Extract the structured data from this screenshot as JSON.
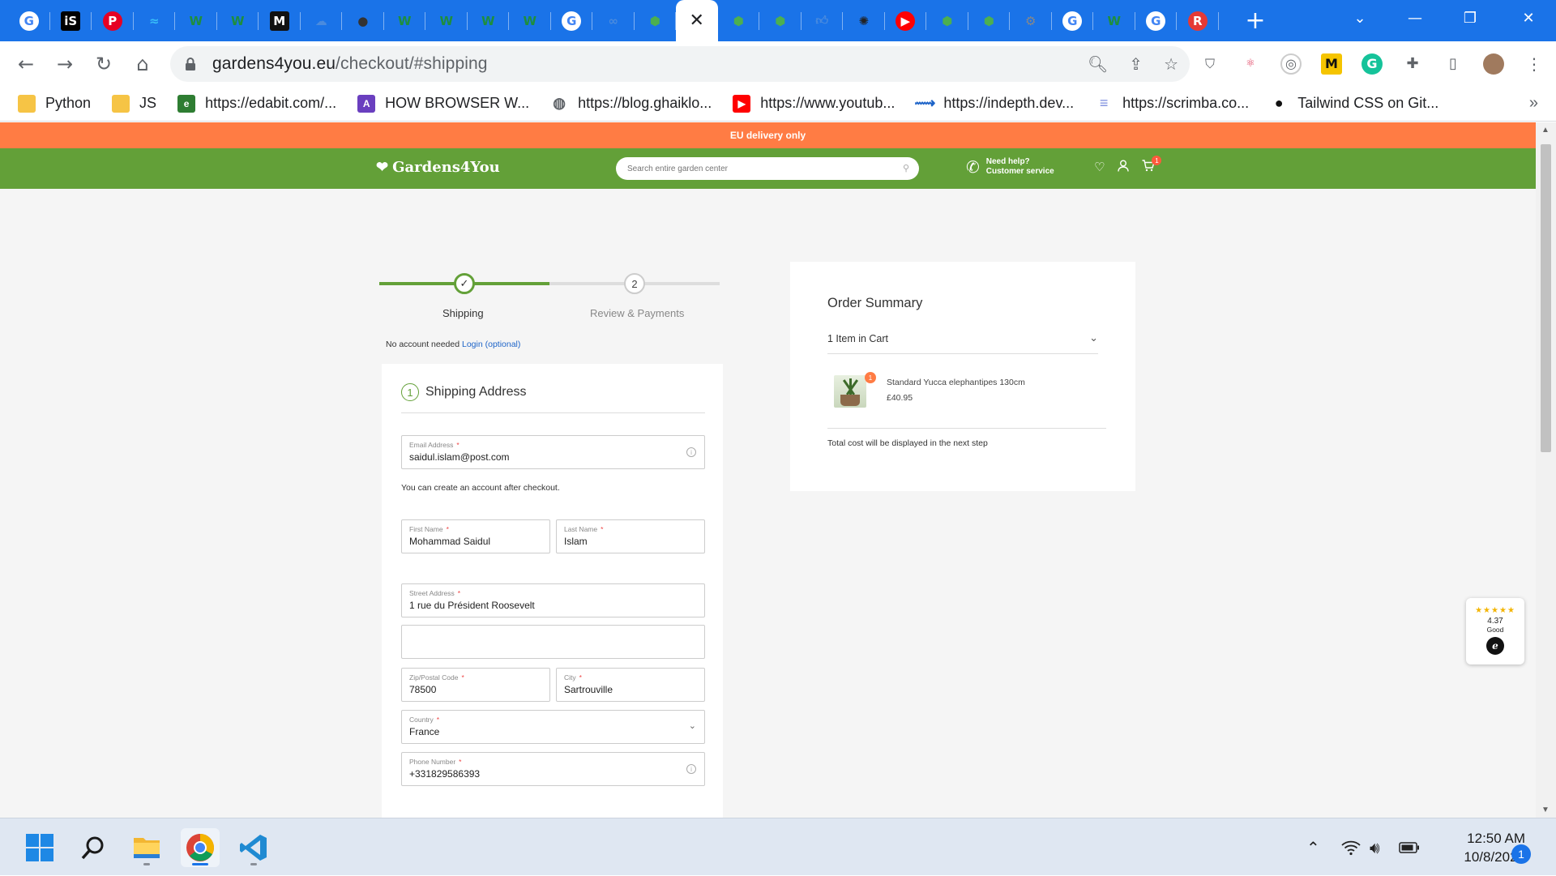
{
  "browser": {
    "tabs": [
      {
        "icon": "google-icon",
        "color": "#ffffff"
      },
      {
        "icon": "is-icon",
        "color": "#000000"
      },
      {
        "icon": "pinterest-icon",
        "color": "#e60023"
      },
      {
        "icon": "tailwind-icon",
        "color": "#38bdf8"
      },
      {
        "icon": "w-icon",
        "color": "#1e8e3e"
      },
      {
        "icon": "w-icon",
        "color": "#1e8e3e"
      },
      {
        "icon": "m-icon",
        "color": "#111111"
      },
      {
        "icon": "cloud-icon",
        "color": "#4a8bde"
      },
      {
        "icon": "github-icon",
        "color": "#333333"
      },
      {
        "icon": "w-icon",
        "color": "#1e8e3e"
      },
      {
        "icon": "w-icon",
        "color": "#1e8e3e"
      },
      {
        "icon": "w-icon",
        "color": "#1e8e3e"
      },
      {
        "icon": "w-icon",
        "color": "#1e8e3e"
      },
      {
        "icon": "google-icon",
        "color": "#ffffff"
      },
      {
        "icon": "link-icon",
        "color": "#4a8bde"
      },
      {
        "icon": "gardens-icon",
        "color": "#4caf50"
      },
      {
        "icon": "close-icon",
        "active": true
      },
      {
        "icon": "gardens-icon",
        "color": "#4caf50"
      },
      {
        "icon": "gardens-icon",
        "color": "#4caf50"
      },
      {
        "icon": "thumb-icon",
        "color": "#4a8bde"
      },
      {
        "icon": "spider-icon",
        "color": "#222222"
      },
      {
        "icon": "youtube-icon",
        "color": "#ff0000"
      },
      {
        "icon": "gardens-icon",
        "color": "#4caf50"
      },
      {
        "icon": "gardens-icon",
        "color": "#4caf50"
      },
      {
        "icon": "gear-icon",
        "color": "#888888"
      },
      {
        "icon": "google-icon",
        "color": "#ffffff"
      },
      {
        "icon": "w-icon",
        "color": "#1e8e3e"
      },
      {
        "icon": "google-icon",
        "color": "#ffffff"
      },
      {
        "icon": "r-icon",
        "color": "#e53935"
      }
    ],
    "url_host": "gardens4you.eu",
    "url_path": "/checkout/#shipping",
    "bookmarks": [
      {
        "label": "Python",
        "icon": "folder-icon",
        "color": "#f6c445"
      },
      {
        "label": "JS",
        "icon": "folder-icon",
        "color": "#f6c445"
      },
      {
        "label": "https://edabit.com/...",
        "icon": "edabit-icon",
        "color": "#2e7d32"
      },
      {
        "label": "HOW BROWSER W...",
        "icon": "rocket-icon",
        "color": "#6a3fbf"
      },
      {
        "label": "https://blog.ghaiklo...",
        "icon": "globe-icon",
        "color": "#5f6368"
      },
      {
        "label": "https://www.youtub...",
        "icon": "youtube-icon",
        "color": "#ff0000"
      },
      {
        "label": "https://indepth.dev...",
        "icon": "shoe-icon",
        "color": "#1e64c8"
      },
      {
        "label": "https://scrimba.co...",
        "icon": "scrimba-icon",
        "color": "#7b8cde"
      },
      {
        "label": "Tailwind CSS on Git...",
        "icon": "github-icon",
        "color": "#111111"
      }
    ]
  },
  "site": {
    "promo": "EU delivery only",
    "logo": "Gardens4You",
    "search_placeholder": "Search entire garden center",
    "help_line1": "Need help?",
    "help_line2": "Customer service",
    "cart_count": "1",
    "colors": {
      "brand_green": "#63a038",
      "promo_orange": "#ff7c44"
    }
  },
  "checkout": {
    "steps": [
      {
        "label": "Shipping",
        "state": "done"
      },
      {
        "num": "2",
        "label": "Review & Payments",
        "state": "pending"
      }
    ],
    "no_account": "No account needed",
    "login_link": "Login (optional)",
    "section_num": "1",
    "section_title": "Shipping Address",
    "account_hint": "You can create an account after checkout.",
    "required_mark": "*",
    "fields": {
      "email": {
        "label": "Email Address",
        "value": "saidul.islam@post.com"
      },
      "first_name": {
        "label": "First Name",
        "value": "Mohammad Saidul"
      },
      "last_name": {
        "label": "Last Name",
        "value": "Islam"
      },
      "street": {
        "label": "Street Address",
        "value": "1 rue du Président Roosevelt"
      },
      "street2": {
        "label": "",
        "value": ""
      },
      "zip": {
        "label": "Zip/Postal Code",
        "value": "78500"
      },
      "city": {
        "label": "City",
        "value": "Sartrouville"
      },
      "country": {
        "label": "Country",
        "value": "France"
      },
      "phone": {
        "label": "Phone Number",
        "value": "+331829586393"
      }
    }
  },
  "summary": {
    "title": "Order Summary",
    "items_count": "1 Item in Cart",
    "item_badge": "1",
    "item_name": "Standard Yucca elephantipes 130cm",
    "item_price": "£40.95",
    "note": "Total cost will be displayed in the next step"
  },
  "rating_widget": {
    "stars": "★★★★★",
    "score": "4.37",
    "word": "Good",
    "mark": "e"
  },
  "taskbar": {
    "apps": [
      {
        "name": "windows-start-icon"
      },
      {
        "name": "search-icon"
      },
      {
        "name": "file-explorer-icon"
      },
      {
        "name": "chrome-icon",
        "active": true
      },
      {
        "name": "vscode-icon"
      }
    ],
    "time": "12:50 AM",
    "date": "10/8/2022",
    "notifications": "1"
  }
}
